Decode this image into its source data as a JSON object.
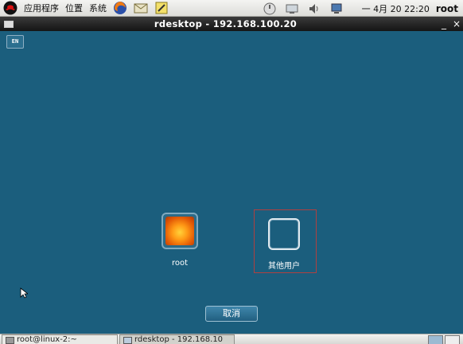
{
  "top_panel": {
    "menus": [
      "应用程序",
      "位置",
      "系统"
    ],
    "clock": "一 4月 20 22:20",
    "user": "root"
  },
  "window": {
    "title": "rdesktop - 192.168.100.20",
    "minimize": "_",
    "close": "×"
  },
  "remote": {
    "language": "EN",
    "users": [
      {
        "label": "root"
      },
      {
        "label": "其他用户"
      }
    ],
    "cancel_label": "取消"
  },
  "taskbar": {
    "tasks": [
      {
        "label": "root@linux-2:~"
      },
      {
        "label": "rdesktop - 192.168.10"
      }
    ]
  },
  "colors": {
    "desktop_bg": "#1b5e7d",
    "selection_border": "#b04040"
  }
}
